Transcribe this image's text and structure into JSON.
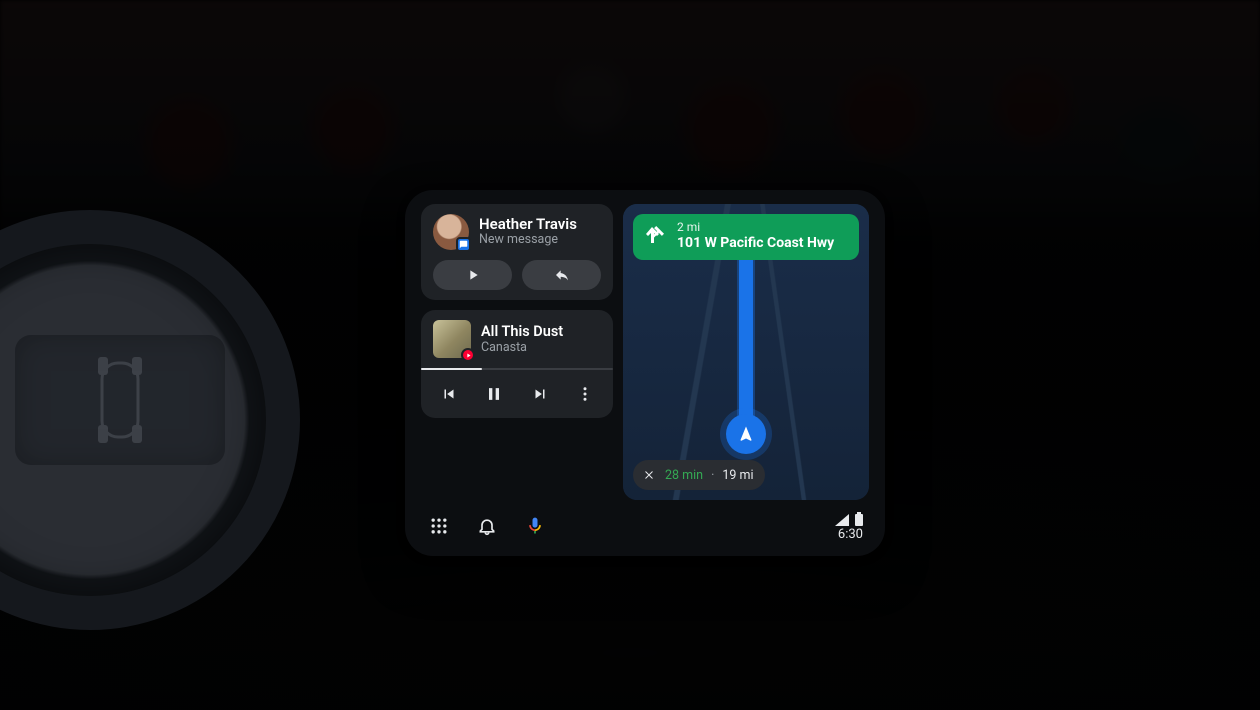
{
  "message": {
    "sender": "Heather Travis",
    "subtitle": "New message"
  },
  "media": {
    "track_title": "All This Dust",
    "artist": "Canasta",
    "progress_pct": 32
  },
  "navigation": {
    "turn_distance": "2 mi",
    "road_name": "101 W Pacific Coast Hwy",
    "eta_time": "28 min",
    "eta_distance": "19 mi",
    "eta_separator": "·"
  },
  "statusbar": {
    "clock": "6:30"
  },
  "colors": {
    "accent_blue": "#1a73e8",
    "accent_green": "#0f9d58",
    "eta_green": "#34a853"
  }
}
